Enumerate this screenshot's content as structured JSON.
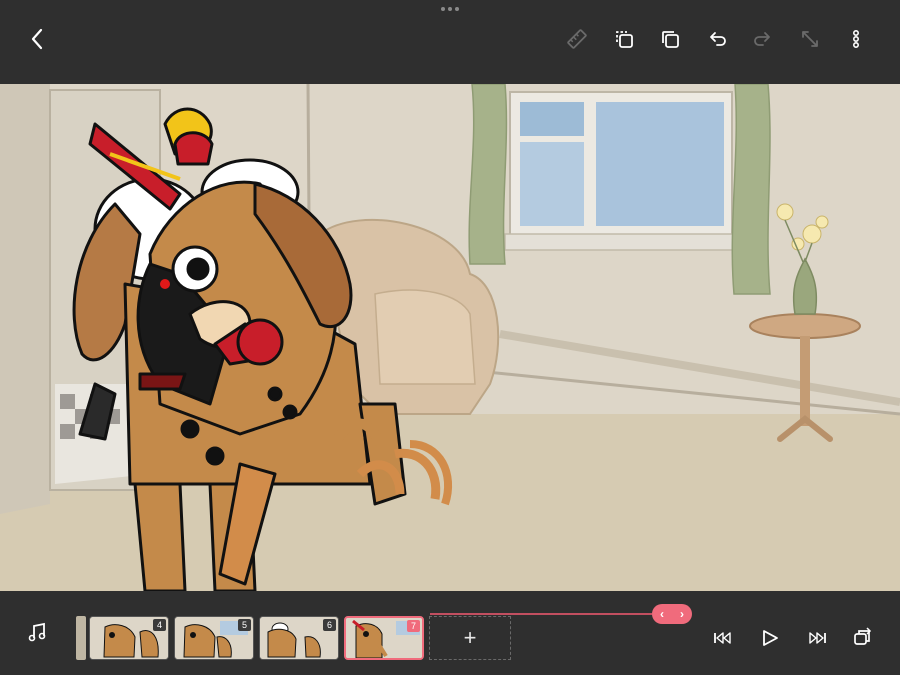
{
  "toolbar": {
    "icons": [
      "back-icon",
      "ruler-icon",
      "copy-frame-icon",
      "duplicate-icon",
      "undo-icon",
      "redo-icon",
      "resize-icon",
      "more-icon"
    ]
  },
  "timeline": {
    "frames": [
      {
        "number": "4"
      },
      {
        "number": "5"
      },
      {
        "number": "6"
      },
      {
        "number": "7",
        "selected": true
      }
    ],
    "add_label": "+",
    "scrubber": {
      "left": "‹",
      "right": "›"
    }
  },
  "colors": {
    "accent": "#f06b7c",
    "bar": "#2f2f2f",
    "dog_brown": "#c48a4a",
    "bow_red": "#c81e2a"
  }
}
